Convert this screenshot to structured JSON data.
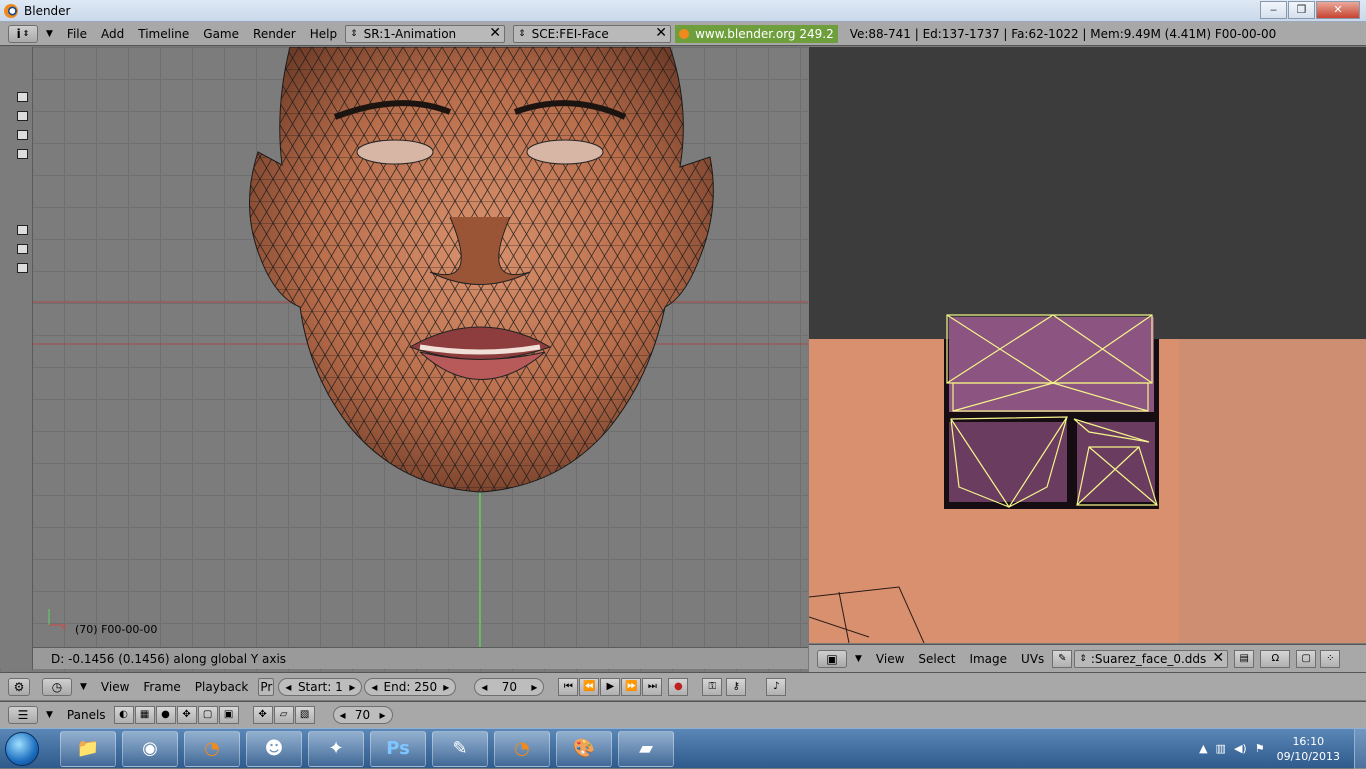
{
  "window": {
    "title": "Blender"
  },
  "info_header": {
    "menus": [
      "File",
      "Add",
      "Timeline",
      "Game",
      "Render",
      "Help"
    ],
    "screen": "SR:1-Animation",
    "scene": "SCE:FEI-Face",
    "url": "www.blender.org 249.2",
    "stats": "Ve:88-741 | Ed:137-1737 | Fa:62-1022 | Mem:9.49M (4.41M) F00-00-00"
  },
  "viewport": {
    "frame_label": "(70) F00-00-00",
    "status": "D: -0.1456 (0.1456) along global Y axis",
    "axis_x": "x"
  },
  "uv_header": {
    "menus": [
      "View",
      "Select",
      "Image",
      "UVs"
    ],
    "image": ":Suarez_face_0.dds"
  },
  "timeline": {
    "menus": [
      "View",
      "Frame",
      "Playback"
    ],
    "pr": "Pr",
    "start": "Start: 1",
    "end": "End: 250",
    "current": "70"
  },
  "buttons_header": {
    "panels": "Panels",
    "frame": "70"
  },
  "taskbar": {
    "time": "16:10",
    "date": "09/10/2013",
    "apps": [
      "file-explorer-icon",
      "chrome-icon",
      "blender-icon",
      "game-icon",
      "counter-strike-icon",
      "photoshop-icon",
      "archive-icon",
      "blender-icon",
      "paint-icon",
      "notepad-icon"
    ],
    "ps_label": "Ps"
  },
  "colors": {
    "wire": "#1a1a1a",
    "uv_select": "#f4f48a",
    "y_axis": "#5cd65c",
    "x_axis": "#a84848"
  }
}
